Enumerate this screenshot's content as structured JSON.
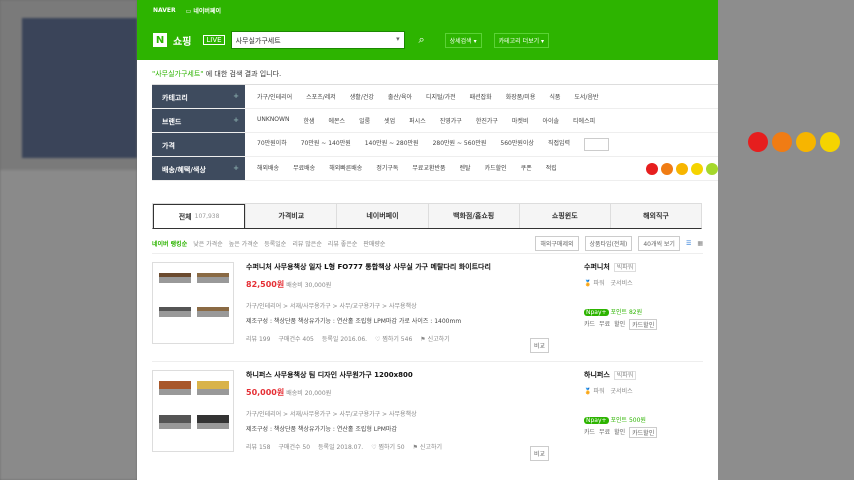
{
  "topbar": {
    "naver": "NAVER",
    "pay": "네이버페이"
  },
  "header": {
    "logo": "N",
    "shop": "쇼핑",
    "live": "LIVE",
    "query": "사무실가구세트",
    "adv": "상세검색 ▾",
    "catmore": "카테고리 더보기 ▾"
  },
  "result": {
    "kw": "\"사무실가구세트\"",
    "rest": " 에 대한 검색 결과 입니다."
  },
  "filters": [
    {
      "label": "카테고리",
      "values": [
        "가구/인테리어",
        "스포츠/레저",
        "생활/건강",
        "출산/육아",
        "디지털/가전",
        "패션잡화",
        "화장품/미용",
        "식품",
        "도서/음반"
      ]
    },
    {
      "label": "브랜드",
      "values": [
        "UNKNOWN",
        "한샘",
        "에몬스",
        "일룸",
        "셋업",
        "퍼시스",
        "진영가구",
        "한진가구",
        "마켓비",
        "아이솔",
        "티에스피"
      ]
    },
    {
      "label": "가격",
      "values": [
        "70만원이하",
        "70만원 ~ 140만원",
        "140만원 ~ 280만원",
        "280만원 ~ 560만원",
        "560만원이상",
        "직접입력"
      ]
    },
    {
      "label": "배송/혜택/색상",
      "values": [
        "해외배송",
        "무료배송",
        "해외빠른배송",
        "정기구독",
        "무료교환반품",
        "렌탈",
        "카드할인",
        "쿠폰",
        "적립"
      ]
    }
  ],
  "filterColors": [
    "#e61e1e",
    "#f07c14",
    "#f7b500",
    "#f5d400",
    "#a5d82c"
  ],
  "bgColors": [
    "#e61e1e",
    "#f07c14",
    "#f7b500",
    "#f5d400"
  ],
  "tabs": [
    "전체",
    "가격비교",
    "네이버페이",
    "백화점/홈쇼핑",
    "쇼핑윈도",
    "해외직구"
  ],
  "tabCount": "107,938",
  "sort": {
    "items": [
      "네이버 랭킹순",
      "낮은 가격순",
      "높은 가격순",
      "등록일순",
      "리뷰 많은순",
      "리뷰 좋은순",
      "판매량순"
    ],
    "select1": "해외구매제외",
    "select2": "상품타입(전체)",
    "select3": "40개씩 보기"
  },
  "items": [
    {
      "title": "수퍼니처 사무용책상 일자 L형 FO777 통합책상 사무실 가구 메탈다리 화이트다리",
      "price": "82,500원",
      "ship": "배송비 30,000원",
      "cat": "가구/인테리어 > 서재/사무용가구 > 사무/교구용가구 > 사무용책상",
      "spec": "제조구성 : 책상단품    책상유가기능 : 연산홀 조립형 LPM마감    가로 사이즈 : 1400mm",
      "review": "리뷰 199",
      "buy": "구매건수 405",
      "date": "등록일 2016.06.",
      "zzim": "찜하기 546",
      "report": "신고하기",
      "compare": "비교",
      "store": "수퍼니처",
      "grade": "빅파워",
      "line1": "파워",
      "line2": "굿서비스",
      "npay": "포인트 82원",
      "tags": [
        "카드",
        "무료",
        "할인"
      ],
      "tagbox": "카드할인"
    },
    {
      "title": "하니퍼스 사무용책상 팀 디자인 사무원가구 1200x800",
      "price": "50,000원",
      "ship": "배송비 20,000원",
      "cat": "가구/인테리어 > 서재/사무용가구 > 사무/교구용가구 > 사무용책상",
      "spec": "제조구성 : 책상단품    책상유가기능 : 연산홀 조립형 LPM마감",
      "review": "리뷰 158",
      "buy": "구매건수 50",
      "date": "등록일 2018.07.",
      "zzim": "찜하기 50",
      "report": "신고하기",
      "compare": "비교",
      "store": "하니퍼스",
      "grade": "빅파워",
      "line1": "파워",
      "line2": "굿서비스",
      "npay": "포인트 500원",
      "tags": [
        "카드",
        "무료",
        "할인"
      ],
      "tagbox": "카드할인"
    }
  ]
}
